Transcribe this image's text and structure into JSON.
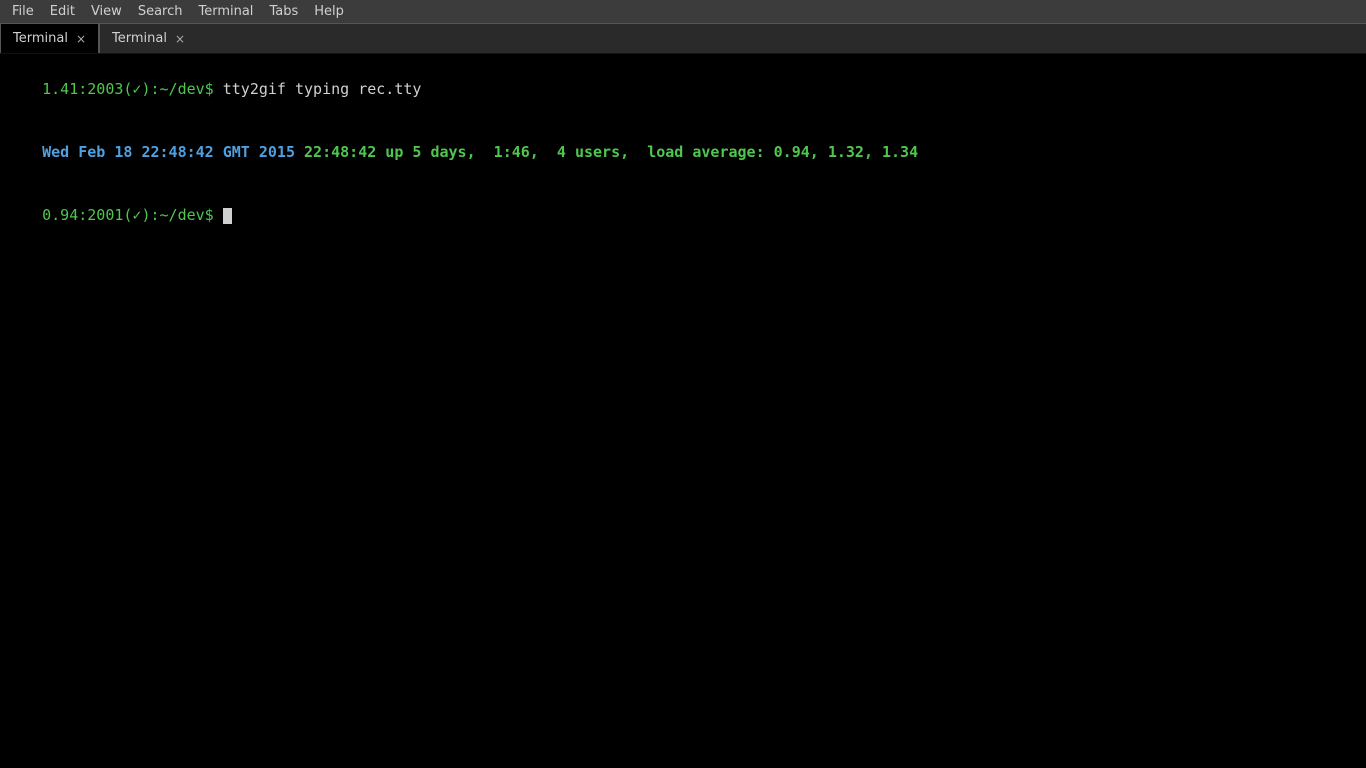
{
  "menubar": {
    "items": [
      "File",
      "Edit",
      "View",
      "Search",
      "Terminal",
      "Tabs",
      "Help"
    ]
  },
  "tabs": {
    "active_tab_label": "Terminal",
    "active_tab_close": "×",
    "inactive_tab_label": "Terminal",
    "window_close": "×"
  },
  "terminal": {
    "line1_prefix": "1.41:2003(✓):~/dev$ ",
    "line1_cmd": "tty2gif typing rec.tty",
    "line2_date": "Wed Feb 18 22:48:42 GMT 2015",
    "line2_uptime": " 22:48:42 up 5 days,  1:46,  4 users,  load average: 0.94, 1.32, 1.34",
    "line3_prefix": "0.94:2001(✓):~/dev$ "
  }
}
